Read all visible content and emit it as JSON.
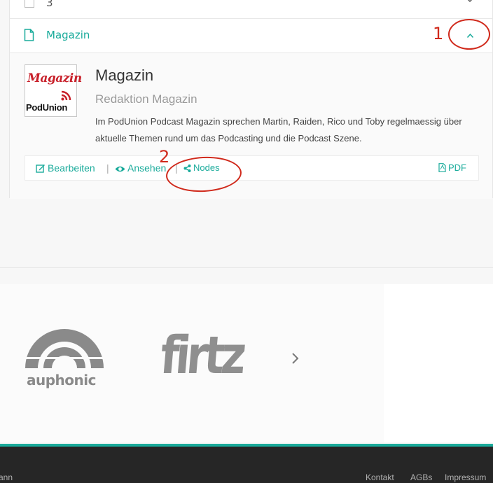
{
  "list": {
    "prev_row_number": "3",
    "row_title": "Magazin"
  },
  "detail": {
    "logo_text_top": "Magazin",
    "logo_text_bottom": "PodUnion",
    "title": "Magazin",
    "subtitle": "Redaktion Magazin",
    "description": "Im PodUnion Podcast Magazin sprechen Martin, Raiden, Rico und Toby regelmaessig über aktuelle Themen rund um das Podcasting und die Podcast Szene.",
    "actions": {
      "edit": "Bearbeiten",
      "view": "Ansehen",
      "nodes": "Nodes",
      "pdf": "PDF",
      "separator": "|"
    }
  },
  "annotations": {
    "one": "1",
    "two": "2"
  },
  "partners": {
    "auphonic": "auphonic",
    "firtz": "firtz"
  },
  "footer": {
    "left_text": "ann",
    "links": [
      "Kontakt",
      "AGBs",
      "Impressum"
    ]
  },
  "colors": {
    "accent": "#1aab9b",
    "annotation": "#d0291b",
    "footer_bg": "#262626"
  }
}
